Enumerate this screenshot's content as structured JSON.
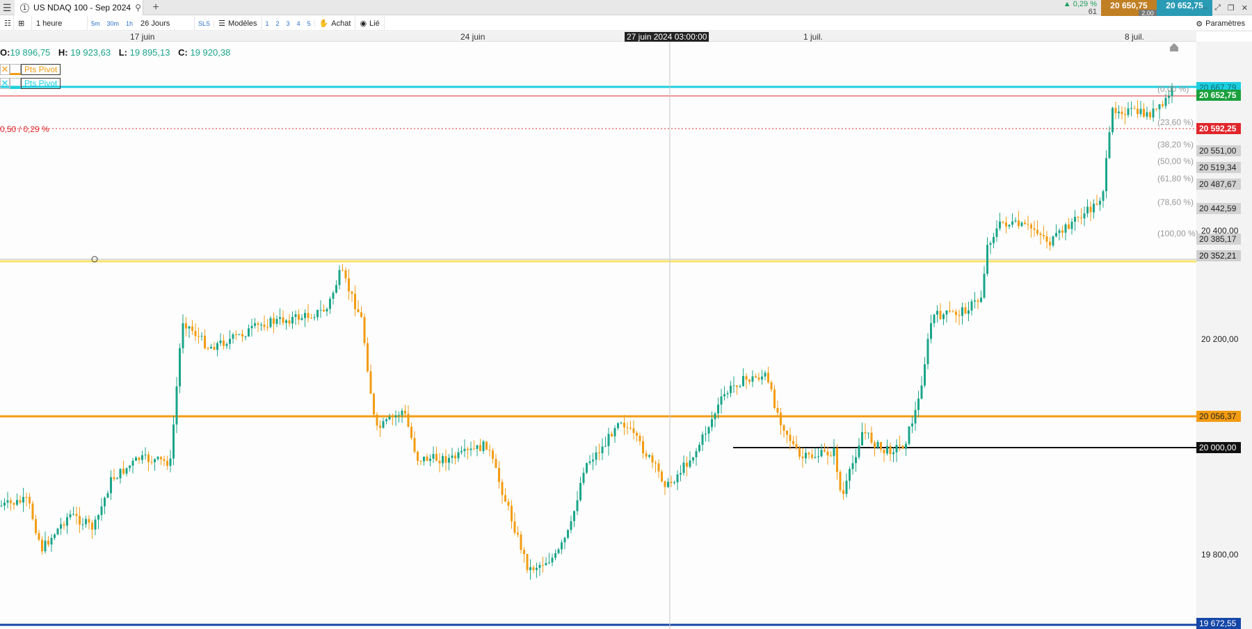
{
  "titlebar": {
    "tab_title": "US NDAQ 100 - Sep 2024",
    "tab_number": "1",
    "add": "+",
    "change_pct": "▲ 0,29 %",
    "change_pts": "61",
    "bid": "20 650,75",
    "ask": "20 652,75",
    "spread": "2,00"
  },
  "toolbar": {
    "interval": "1 heure",
    "quick": [
      "5m",
      "30m",
      "1h"
    ],
    "period": "26 Jours",
    "sls": "SLS",
    "models": "Modèles",
    "layouts": [
      "1",
      "2",
      "3",
      "4",
      "5"
    ],
    "buy": "Achat",
    "linked": "Lié",
    "settings": "Paramètres"
  },
  "time_axis": {
    "labels": [
      "17 juin",
      "24 juin",
      "1 juil.",
      "8 juil."
    ],
    "crosshair": "27 juin 2024 03:00:00"
  },
  "ohlc": {
    "o_label": "O:",
    "o": "19 896,75",
    "h_label": "H:",
    "h": "19 923,63",
    "l_label": "L:",
    "l": "19 895,13",
    "c_label": "C:",
    "c": "19 920,38"
  },
  "indicators": [
    {
      "label": "Pts Pivot",
      "color": "#f39c12"
    },
    {
      "label": "Pts Pivot",
      "color": "#1ccfe0"
    }
  ],
  "spread_label": "0,50 / 0,29 %",
  "price_axis": {
    "labels": [
      "20 400,00",
      "20 200,00",
      "19 800,00"
    ],
    "tags": [
      {
        "text": "20 667,79",
        "bg": "#1ccfe0",
        "fg": "#0b6b75"
      },
      {
        "text": "20 652,75",
        "bg": "#1aa03c",
        "fg": "#ffffff"
      },
      {
        "text": "20 592,25",
        "bg": "#e0262b",
        "fg": "#ffffff"
      },
      {
        "text": "20 551,00",
        "bg": "#d2d2d2",
        "fg": "#222222"
      },
      {
        "text": "20 519,34",
        "bg": "#d2d2d2",
        "fg": "#222222"
      },
      {
        "text": "20 487,67",
        "bg": "#d2d2d2",
        "fg": "#222222"
      },
      {
        "text": "20 442,59",
        "bg": "#d2d2d2",
        "fg": "#222222"
      },
      {
        "text": "20 385,17",
        "bg": "#d2d2d2",
        "fg": "#222222"
      },
      {
        "text": "20 352,21",
        "bg": "#cfcfcf",
        "fg": "#111111"
      },
      {
        "text": "20 056,37",
        "bg": "#f39c12",
        "fg": "#222222"
      },
      {
        "text": "20 000,00",
        "bg": "#111111",
        "fg": "#ffffff"
      },
      {
        "text": "19 672,55",
        "bg": "#1446a8",
        "fg": "#ffffff"
      }
    ],
    "fib": [
      "(0,00 %)",
      "(23,60 %)",
      "(38,20 %)",
      "(50,00 %)",
      "(61,80 %)",
      "(78,60 %)",
      "(100,00 %)"
    ]
  },
  "colors": {
    "up": "#1aa58a",
    "down": "#f39c12"
  }
}
